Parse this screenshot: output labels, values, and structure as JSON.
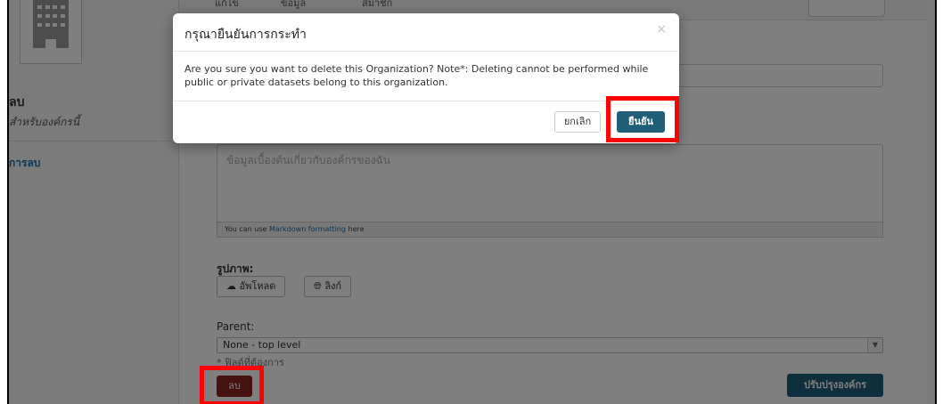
{
  "sidebar": {
    "title": "ลบ",
    "subtitle": "สำหรับองค์กรนี้",
    "link": "การลบ"
  },
  "topbar": {
    "tabs": [
      "แก้ไข",
      "ข้อมูล",
      "สมาชิก"
    ]
  },
  "form": {
    "description_placeholder": "ข้อมูลเบื้องต้นเกี่ยวกับองค์กรของฉัน",
    "markdown_note_prefix": "You can use ",
    "markdown_link": "Markdown formatting",
    "markdown_note_suffix": " here",
    "image_label": "รูปภาพ:",
    "upload_button": "อัพโหลด",
    "link_button": "ลิงก์",
    "parent_label": "Parent:",
    "parent_value": "None - top level",
    "required_note": "* ฟิลด์ที่ต้องการ",
    "delete_button": "ลบ",
    "update_button": "ปรับปรุงองค์กร"
  },
  "modal": {
    "title": "กรุณายืนยันการกระทำ",
    "close": "×",
    "message": "Are you sure you want to delete this Organization? Note*: Deleting cannot be performed while public or private datasets belong to this organization.",
    "cancel": "ยกเลิก",
    "confirm": "ยืนยัน"
  },
  "colors": {
    "primary": "#205e78",
    "danger": "#8b2420",
    "highlight": "#ff0000"
  }
}
